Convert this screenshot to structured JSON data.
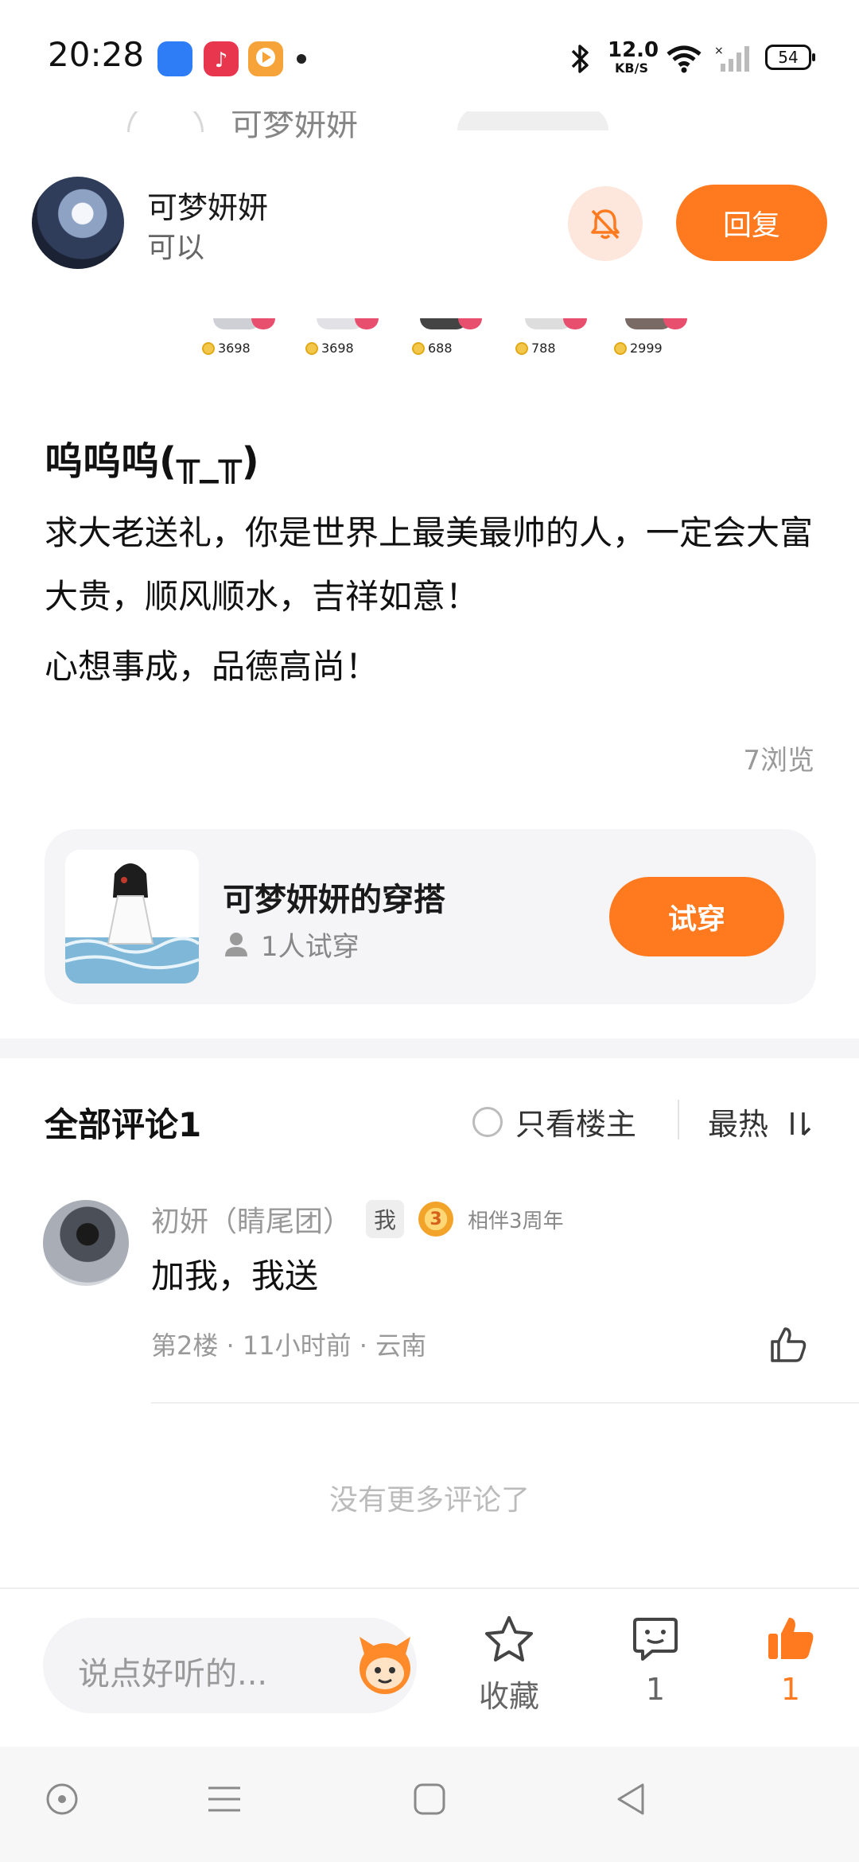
{
  "status_bar": {
    "time": "20:28",
    "net_speed_value": "12.0",
    "net_speed_unit": "KB/S",
    "battery": "54",
    "icons": [
      "app-blue-icon",
      "music-app-icon",
      "video-app-icon",
      "notification-dot-icon",
      "bluetooth-icon",
      "wifi-icon",
      "signal-icon",
      "battery-icon"
    ],
    "app_colors": [
      "#2e7df6",
      "#e8364f",
      "#f6a33a"
    ]
  },
  "header": {
    "ghost_title": "可梦妍妍",
    "author_name": "可梦妍妍",
    "author_subtitle": "可以",
    "bell_icon": "bell-off-icon",
    "reply_label": "回复"
  },
  "gifts": [
    {
      "price": "3698"
    },
    {
      "price": "3698"
    },
    {
      "price": "688"
    },
    {
      "price": "788"
    },
    {
      "price": "2999"
    }
  ],
  "post": {
    "title": "呜呜呜(╥_╥)",
    "body": [
      "求大老送礼，你是世界上最美最帅的人，一定会大富大贵，顺风顺水，吉祥如意！",
      "心想事成，品德高尚！"
    ],
    "views": "7浏览"
  },
  "outfit": {
    "title": "可梦妍妍的穿搭",
    "tried": "1人试穿",
    "try_label": "试穿"
  },
  "comments": {
    "title": "全部评论1",
    "only_host": "只看楼主",
    "sort": "最热",
    "items": [
      {
        "name": "初妍（睛尾团）",
        "me_badge": "我",
        "medal_number": "3",
        "medal_text": "相伴3周年",
        "text": "加我，我送",
        "meta": "第2楼 · 11小时前 · 云南"
      }
    ],
    "no_more": "没有更多评论了"
  },
  "bottom_bar": {
    "input_placeholder": "说点好听的...",
    "favorite_label": "收藏",
    "comment_count": "1",
    "like_count": "1"
  },
  "colors": {
    "accent": "#ff7a1f",
    "accent_soft": "#fde6dc"
  }
}
